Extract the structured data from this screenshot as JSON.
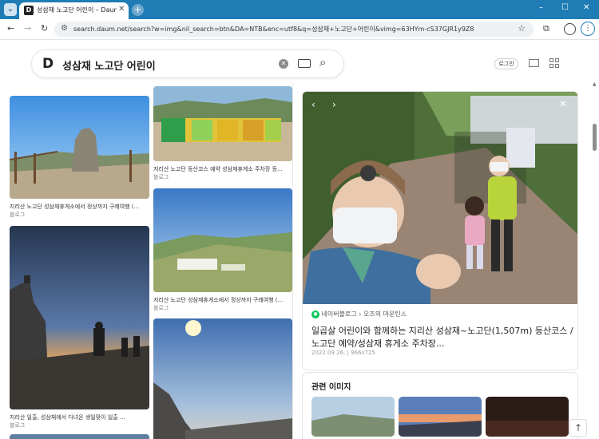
{
  "browser": {
    "tab_title": "성삼재 노고단 어린이 – Daum 검색",
    "tab_favicon": "D",
    "url": "search.daum.net/search?w=img&nil_search=btn&DA=NTB&enc=utf8&q=성삼재+노고단+어린이&vimg=63HYm-cS37GJR1y9Z8",
    "minimize": "–",
    "maximize": "☐",
    "close": "✕"
  },
  "search": {
    "logo": "D",
    "query": "성삼재 노고단 어린이",
    "clear": "✕"
  },
  "header": {
    "login_label": "로그인"
  },
  "results": [
    {
      "caption": "지리산 노고단 성삼재휴게소에서 정상까지 구례여행 (...",
      "source": "블로그"
    },
    {
      "caption": "지리산 일출, 성삼재에서 다녀온 생일맞이 일출 ...",
      "source": "블로그"
    },
    {
      "caption": "지리산 노고단 등산코스 예약 성삼재휴게소 주차장 등...",
      "source": "블로그"
    },
    {
      "caption": "지리산 노고단 성삼재휴게소에서 정상까지 구례여행 (...",
      "source": "블로그"
    }
  ],
  "detail": {
    "source_site": "네이버블로그",
    "source_sep": "›",
    "source_author": "오즈의 마운틴⚠",
    "title_line1": "일곱살 어린이와 함께하는 지리산 성삼재~노고단(1,507m) 등산코스 /",
    "title_line2": "노고단 예약/성삼재 휴게소 주차장...",
    "date": "2022.09.26.",
    "size": "966x725",
    "prev": "‹",
    "next": "›",
    "close": "✕"
  },
  "related": {
    "label": "관련 이미지"
  }
}
